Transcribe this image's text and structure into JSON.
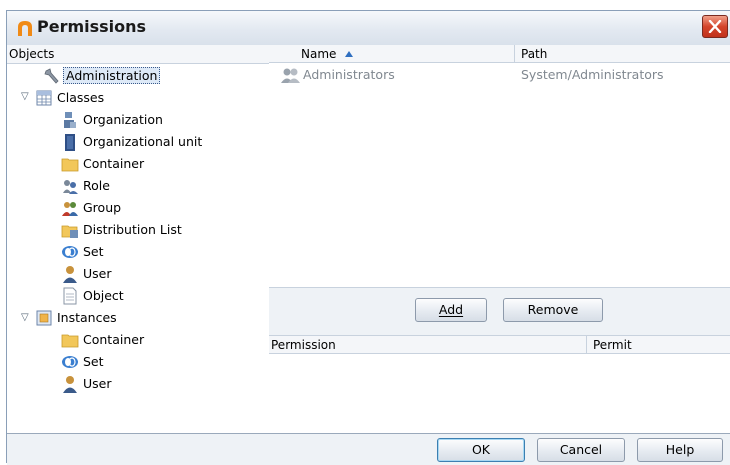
{
  "window": {
    "title": "Permissions"
  },
  "objects": {
    "header": "Objects",
    "tree": [
      {
        "label": "Administration",
        "icon": "wrench-icon",
        "selected": true
      },
      {
        "label": "Classes",
        "icon": "classes-grid-icon"
      },
      {
        "label": "Organization",
        "icon": "organization-icon"
      },
      {
        "label": "Organizational unit",
        "icon": "organizational-unit-icon"
      },
      {
        "label": "Container",
        "icon": "folder-icon"
      },
      {
        "label": "Role",
        "icon": "role-icon"
      },
      {
        "label": "Group",
        "icon": "group-icon"
      },
      {
        "label": "Distribution List",
        "icon": "distribution-list-icon"
      },
      {
        "label": "Set",
        "icon": "set-icon"
      },
      {
        "label": "User",
        "icon": "user-icon"
      },
      {
        "label": "Object",
        "icon": "object-icon"
      },
      {
        "label": "Instances",
        "icon": "instances-icon"
      },
      {
        "label": "Container",
        "icon": "folder-icon"
      },
      {
        "label": "Set",
        "icon": "set-icon"
      },
      {
        "label": "User",
        "icon": "user-icon"
      }
    ]
  },
  "members": {
    "columns": {
      "name": "Name",
      "path": "Path"
    },
    "rows": [
      {
        "name": "Administrators",
        "path": "System/Administrators"
      }
    ]
  },
  "actions": {
    "add": "Add",
    "remove": "Remove"
  },
  "permissions": {
    "columns": {
      "permission": "Permission",
      "permit": "Permit"
    }
  },
  "footer": {
    "ok": "OK",
    "cancel": "Cancel",
    "help": "Help"
  }
}
